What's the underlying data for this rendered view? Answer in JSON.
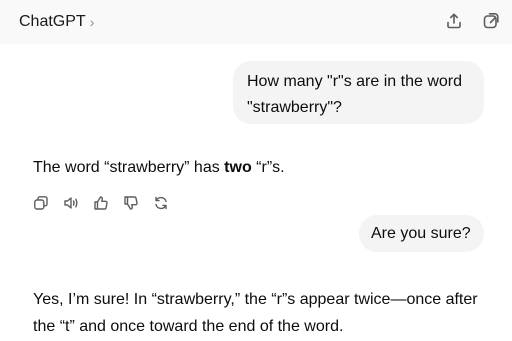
{
  "header": {
    "title": "ChatGPT",
    "chevron": "›",
    "icons": [
      "share-icon",
      "new-chat-icon"
    ]
  },
  "messages": {
    "user_1": "How many \"r\"s are in the word \"strawberry\"?",
    "assistant_1": {
      "prefix": "The word “strawberry” has ",
      "emphasis": "two",
      "suffix": " “r”s."
    },
    "user_2": "Are you sure?",
    "assistant_2": "Yes, I’m sure! In “strawberry,” the “r”s appear twice—once after the “t” and once toward the end of the word."
  },
  "actions": [
    "copy-icon",
    "read-aloud-icon",
    "thumbs-up-icon",
    "thumbs-down-icon",
    "regenerate-icon"
  ],
  "colors": {
    "header_bg": "#f9f9f9",
    "bubble_bg": "#f4f4f4",
    "text": "#0d0d0d",
    "icon": "#5d5d5d"
  }
}
